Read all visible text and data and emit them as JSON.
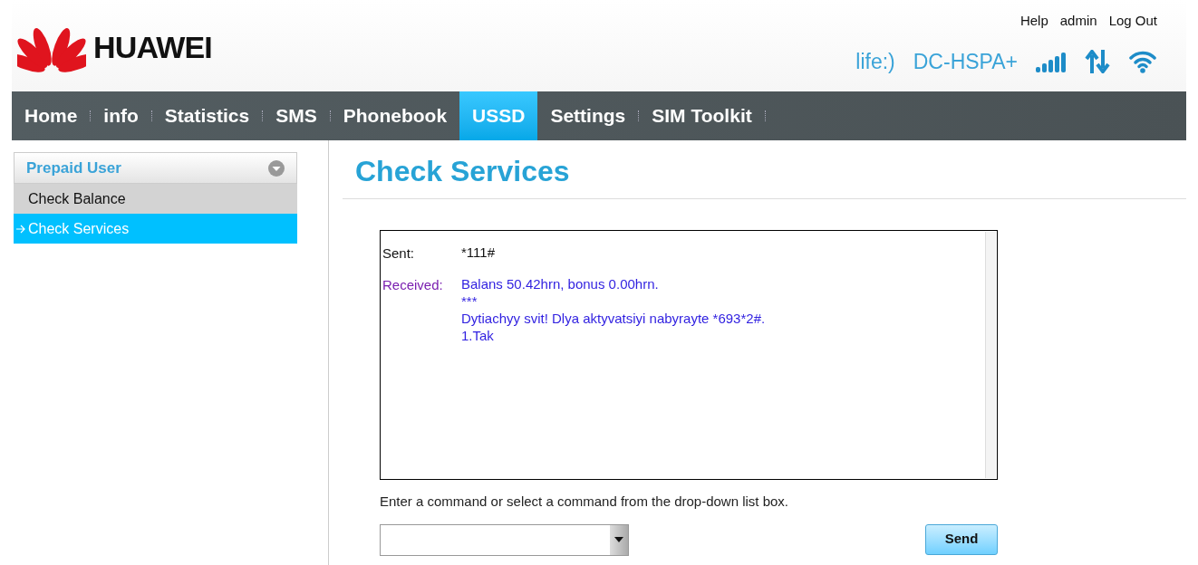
{
  "header": {
    "brand": "HUAWEI",
    "links": [
      "Help",
      "admin",
      "Log Out"
    ],
    "operator": "life:)",
    "network": "DC-HSPA+"
  },
  "nav": [
    {
      "label": "Home",
      "selected": false
    },
    {
      "label": "info",
      "selected": false
    },
    {
      "label": "Statistics",
      "selected": false
    },
    {
      "label": "SMS",
      "selected": false
    },
    {
      "label": "Phonebook",
      "selected": false
    },
    {
      "label": "USSD",
      "selected": true
    },
    {
      "label": "Settings",
      "selected": false
    },
    {
      "label": "SIM Toolkit",
      "selected": false
    }
  ],
  "sidebar": {
    "group": "Prepaid User",
    "expanded": true,
    "items": [
      {
        "label": "Check Balance",
        "selected": false
      },
      {
        "label": "Check Services",
        "selected": true
      }
    ]
  },
  "page_title": "Check Services",
  "log": [
    {
      "kind": "sent",
      "label": "Sent:",
      "lines": [
        "*111#"
      ]
    },
    {
      "kind": "received",
      "label": "Received:",
      "lines": [
        "Balans 50.42hrn, bonus 0.00hrn.",
        "***",
        "Dytiachyy svit! Dlya aktyvatsiyi nabyrayte *693*2#.",
        "1.Tak"
      ]
    }
  ],
  "hint": "Enter a command or select a command from the drop-down list box.",
  "send_button": "Send"
}
